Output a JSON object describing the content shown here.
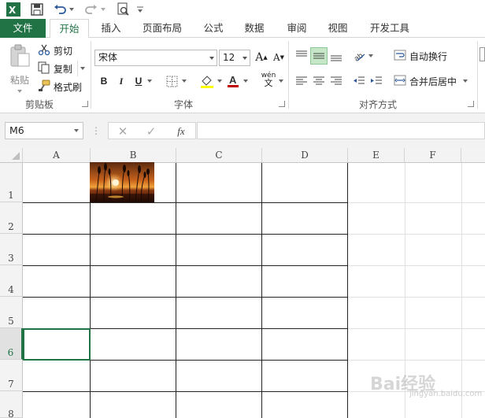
{
  "ribbon_tabs": {
    "file": "文件",
    "home": "开始",
    "insert": "插入",
    "page_layout": "页面布局",
    "formulas": "公式",
    "data": "数据",
    "review": "审阅",
    "view": "视图",
    "developer": "开发工具"
  },
  "clipboard": {
    "paste": "粘贴",
    "cut": "剪切",
    "copy": "复制",
    "format_painter": "格式刷",
    "label": "剪贴板"
  },
  "font": {
    "family": "宋体",
    "size": "12",
    "bold": "B",
    "italic": "I",
    "underline": "U",
    "phonetic": "wén",
    "label": "字体"
  },
  "alignment": {
    "wrap_text": "自动换行",
    "merge_center": "合并后居中",
    "label": "对齐方式"
  },
  "formula_bar": {
    "name_box": "M6",
    "fx": "fx"
  },
  "grid": {
    "columns": [
      "A",
      "B",
      "C",
      "D",
      "E",
      "F"
    ],
    "rows": [
      "1",
      "2",
      "3",
      "4",
      "5",
      "6",
      "7",
      "8"
    ],
    "active_cell": "M6"
  },
  "watermark": {
    "text": "Bai经验",
    "sub": "jingyan.baidu.com"
  },
  "colors": {
    "accent": "#217346",
    "fill_highlight": "#ffff00",
    "font_color": "#c00000"
  }
}
